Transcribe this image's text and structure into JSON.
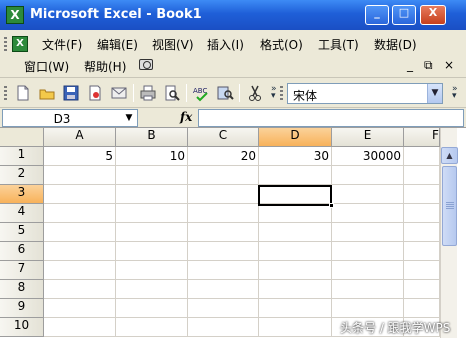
{
  "window": {
    "title": "Microsoft Excel - Book1",
    "controls": [
      "_",
      "□",
      "X"
    ]
  },
  "menu": {
    "items": [
      "文件(F)",
      "编辑(E)",
      "视图(V)",
      "插入(I)",
      "格式(O)",
      "工具(T)",
      "数据(D)"
    ],
    "row2": [
      "窗口(W)",
      "帮助(H)"
    ],
    "mdi_controls": [
      "_",
      "⧉",
      "×"
    ]
  },
  "toolbar": {
    "font": "宋体"
  },
  "formula_bar": {
    "name_box": "D3",
    "fx": "fx",
    "formula": ""
  },
  "sheet": {
    "columns": [
      "A",
      "B",
      "C",
      "D",
      "E",
      "F"
    ],
    "rows": [
      "1",
      "2",
      "3",
      "4",
      "5",
      "6",
      "7",
      "8",
      "9",
      "10"
    ],
    "row1_values": [
      "5",
      "10",
      "20",
      "30",
      "30000"
    ],
    "active_column": "D",
    "active_row": "3"
  },
  "watermark": "头条号 / 跟我学WPS",
  "colors": {
    "title_bar": "#1f5fd8",
    "active_header": "#f8b25a",
    "chrome": "#ece9d8"
  }
}
